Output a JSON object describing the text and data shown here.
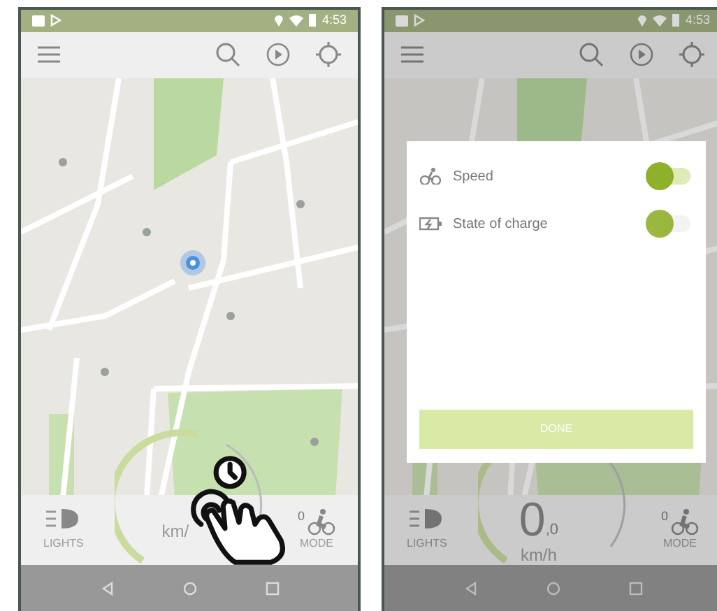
{
  "screens": [
    {
      "status_time": "4:53",
      "lights_label": "LIGHTS",
      "speed": {
        "unit": "km/"
      },
      "mode_count": "0",
      "mode_label": "MODE",
      "gesture_hint": true
    },
    {
      "status_time": "4:53",
      "lights_label": "LIGHTS",
      "speed": {
        "value": "0",
        "decimal": ",0",
        "unit": "km/h"
      },
      "mode_count": "0",
      "mode_label": "MODE",
      "gesture_hint": false,
      "dialog": {
        "items": [
          {
            "kind": "bike",
            "label": "Speed",
            "on": true
          },
          {
            "kind": "battery",
            "label": "State of charge",
            "on": false
          }
        ],
        "button": "DONE"
      }
    }
  ]
}
